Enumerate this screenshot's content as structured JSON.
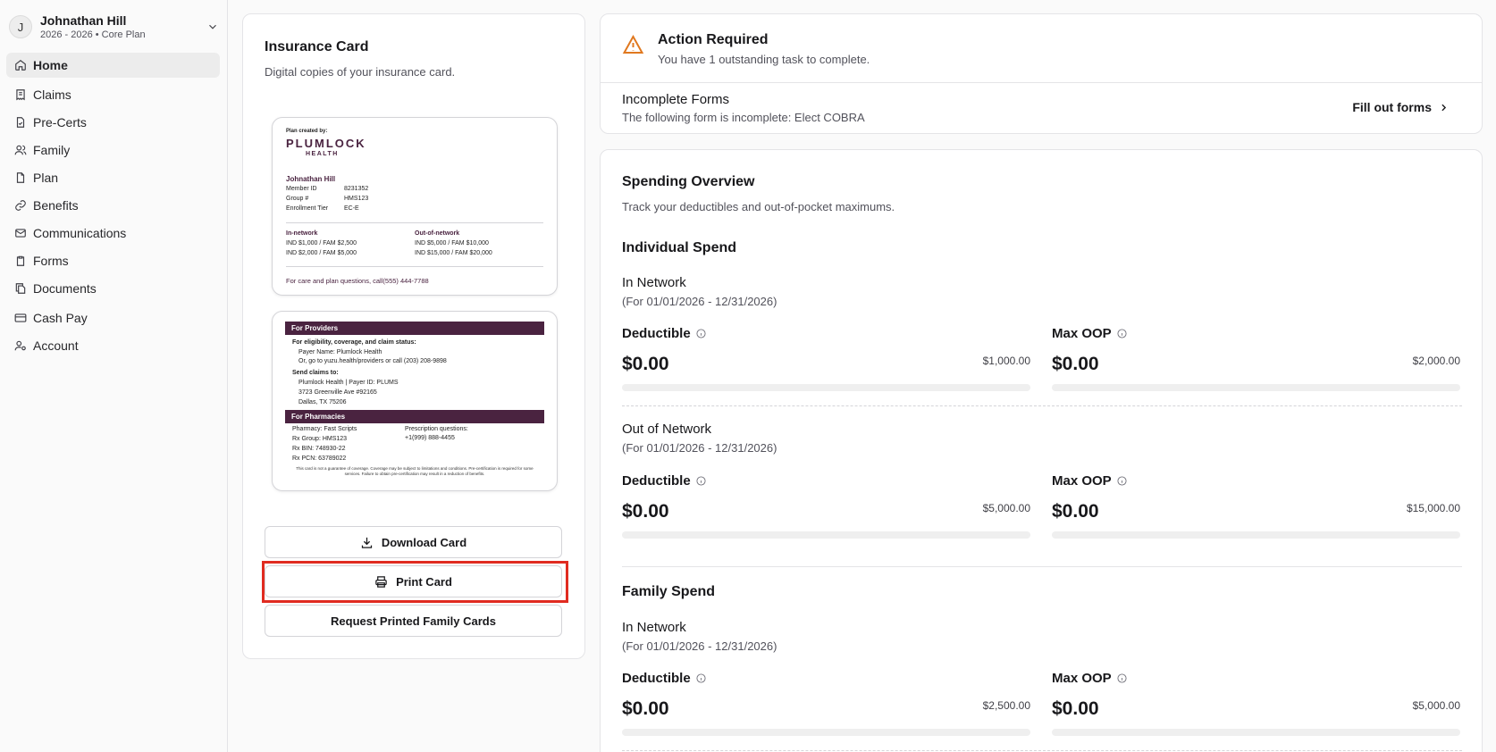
{
  "user": {
    "initial": "J",
    "name": "Johnathan Hill",
    "plan": "2026 - 2026 • Core Plan"
  },
  "nav": [
    {
      "label": "Home",
      "icon": "home-icon"
    },
    {
      "label": "Claims",
      "icon": "receipt-icon"
    },
    {
      "label": "Pre-Certs",
      "icon": "file-check-icon"
    },
    {
      "label": "Family",
      "icon": "users-icon"
    },
    {
      "label": "Plan",
      "icon": "file-icon"
    },
    {
      "label": "Benefits",
      "icon": "link-icon"
    },
    {
      "label": "Communications",
      "icon": "mail-icon"
    },
    {
      "label": "Forms",
      "icon": "clipboard-icon"
    },
    {
      "label": "Documents",
      "icon": "files-icon"
    },
    {
      "label": "Cash Pay",
      "icon": "credit-card-icon"
    },
    {
      "label": "Account",
      "icon": "user-cog-icon"
    }
  ],
  "insurance": {
    "title": "Insurance Card",
    "subtitle": "Digital copies of your insurance card.",
    "front": {
      "created_by": "Plan created by:",
      "logo": "PLUMLOCK",
      "logo_sub": "HEALTH",
      "member_name": "Johnathan Hill",
      "fields": [
        {
          "label": "Member ID",
          "value": "8231352"
        },
        {
          "label": "Group #",
          "value": "HMS123"
        },
        {
          "label": "Enrollment Tier",
          "value": "EC-E"
        }
      ],
      "in_network_label": "In-network",
      "in_network": [
        "IND $1,000 / FAM $2,500",
        "IND $2,000 / FAM $5,000"
      ],
      "out_network_label": "Out-of-network",
      "out_network": [
        "IND $5,000 / FAM $10,000",
        "IND $15,000 / FAM $20,000"
      ],
      "footer": "For care and plan questions, call(555) 444-7788"
    },
    "back": {
      "providers_band": "For Providers",
      "elig_heading": "For eligibility, coverage, and claim status:",
      "payer_name": "Payer Name: Plumlock Health",
      "goto": "Or, go to yuzu.health/providers or call (203) 208-9898",
      "send_heading": "Send claims to:",
      "send_lines": [
        "Plumlock Health | Payer ID: PLUMS",
        "3723 Greenville Ave #92165",
        "Dallas, TX 75206"
      ],
      "pharm_band": "For Pharmacies",
      "pharm_lines": [
        "Pharmacy: Fast Scripts",
        "Rx Group: HMS123",
        "Rx BIN: 748930-22",
        "Rx PCN: 63789022"
      ],
      "rx_q_label": "Prescription questions:",
      "rx_q_phone": "+1(999) 888-4455",
      "disclaimer": "This card is not a guarantee of coverage. Coverage may be subject to limitations and conditions. Pre-certification is required for some services. Failure to obtain pre-certification may result in a reduction of benefits."
    },
    "buttons": {
      "download": "Download Card",
      "print": "Print Card",
      "request": "Request Printed Family Cards"
    }
  },
  "action": {
    "title": "Action Required",
    "subtitle": "You have 1 outstanding task to complete.",
    "form_title": "Incomplete Forms",
    "form_desc": "The following form is incomplete: Elect COBRA",
    "cta": "Fill out forms"
  },
  "spending": {
    "title": "Spending Overview",
    "subtitle": "Track your deductibles and out-of-pocket maximums.",
    "individual_title": "Individual Spend",
    "family_title": "Family Spend",
    "deductible_label": "Deductible",
    "maxoop_label": "Max OOP",
    "sections": [
      {
        "name": "In Network",
        "period": "(For 01/01/2026 - 12/31/2026)",
        "deductible": {
          "value": "$0.00",
          "max": "$1,000.00",
          "progress": 0
        },
        "maxoop": {
          "value": "$0.00",
          "max": "$2,000.00",
          "progress": 0
        }
      },
      {
        "name": "Out of Network",
        "period": "(For 01/01/2026 - 12/31/2026)",
        "deductible": {
          "value": "$0.00",
          "max": "$5,000.00",
          "progress": 0
        },
        "maxoop": {
          "value": "$0.00",
          "max": "$15,000.00",
          "progress": 0
        }
      },
      {
        "name": "In Network",
        "period": "(For 01/01/2026 - 12/31/2026)",
        "deductible": {
          "value": "$0.00",
          "max": "$2,500.00",
          "progress": 0
        },
        "maxoop": {
          "value": "$0.00",
          "max": "$5,000.00",
          "progress": 0
        }
      }
    ]
  },
  "colors": {
    "brand": "#4a2340",
    "warning": "#e0781f",
    "highlight": "#e02b20"
  }
}
